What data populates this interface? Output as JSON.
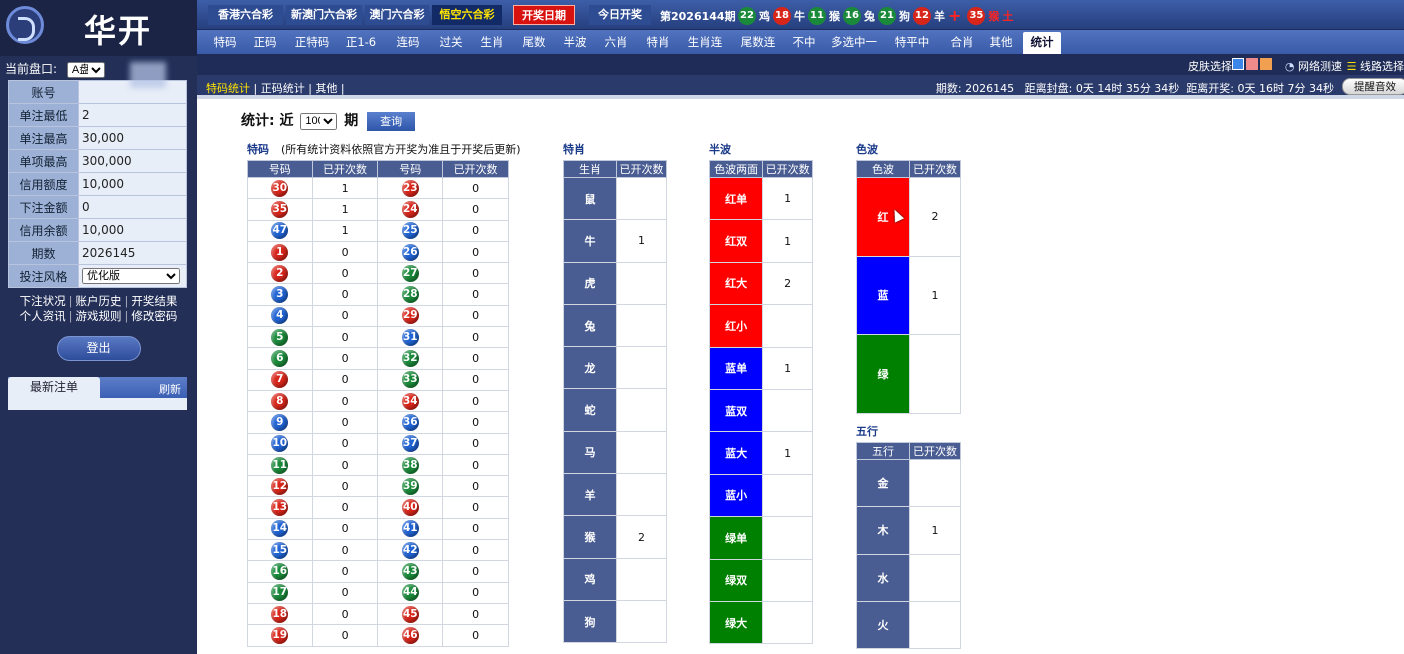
{
  "sidebar": {
    "logo_text": "华开",
    "pan_label": "当前盘口:",
    "pan_value": "A盘",
    "info": [
      {
        "k": "账号",
        "v": ""
      },
      {
        "k": "单注最低",
        "v": "2"
      },
      {
        "k": "单注最高",
        "v": "30,000"
      },
      {
        "k": "单项最高",
        "v": "300,000"
      },
      {
        "k": "信用额度",
        "v": "10,000"
      },
      {
        "k": "下注金额",
        "v": "0"
      },
      {
        "k": "信用余额",
        "v": "10,000"
      },
      {
        "k": "期数",
        "v": "2026145"
      }
    ],
    "style_label": "投注风格",
    "style_value": "优化版",
    "links_row1": [
      "下注状况",
      "账户历史",
      "开奖结果"
    ],
    "links_row2": [
      "个人资讯",
      "游戏规则",
      "修改密码"
    ],
    "logout": "登出",
    "latest_title": "最新注单",
    "refresh": "刷新"
  },
  "topbar": {
    "lottery_tabs": [
      "香港六合彩",
      "新澳门六合彩",
      "澳门六合彩",
      "悟空六合彩"
    ],
    "active_lottery": "悟空六合彩",
    "draw_date": "开奖日期",
    "today_draw": "今日开奖",
    "period_label": "第2026144期",
    "result": [
      {
        "num": "22",
        "color": "green",
        "zodiac": "鸡"
      },
      {
        "num": "18",
        "color": "red",
        "zodiac": "牛"
      },
      {
        "num": "11",
        "color": "green",
        "zodiac": "猴"
      },
      {
        "num": "16",
        "color": "green",
        "zodiac": "兔"
      },
      {
        "num": "21",
        "color": "green",
        "zodiac": "狗"
      },
      {
        "num": "12",
        "color": "red",
        "zodiac": "羊"
      }
    ],
    "special": {
      "num": "35",
      "color": "red",
      "zodiac": "猴",
      "extra": "土"
    }
  },
  "nav": [
    "特码",
    "正码",
    "正特码",
    "正1-6",
    "连码",
    "过关",
    "生肖",
    "尾数",
    "半波",
    "六肖",
    "特肖",
    "生肖连",
    "尾数连",
    "不中",
    "多选中一",
    "特平中",
    "合肖",
    "其他",
    "统计"
  ],
  "active_nav": "统计",
  "toolbar": {
    "skin_label": "皮肤选择",
    "net_test": "网络测速",
    "line_select": "线路选择"
  },
  "subbar": {
    "links": [
      "特码统计",
      "正码统计",
      "其他"
    ],
    "active": "特码统计",
    "period_info": "期数: 2026145",
    "seal_info": "距离封盘: 0天 14时 35分 34秒",
    "open_info": "距离开奖: 0天 16时 7分 34秒",
    "remind": "提醒音效"
  },
  "stats": {
    "prefix": "统计: 近",
    "count": "100",
    "suffix": "期",
    "query": "查询",
    "note": "(所有统计资料依照官方开奖为准且于开奖后更新)",
    "tm_title": "特码",
    "sx_title": "特肖",
    "bb_title": "半波",
    "sb_title": "色波",
    "wx_title": "五行",
    "h_number": "号码",
    "h_count": "已开次数",
    "h_zodiac": "生肖",
    "h_bb": "色波两面",
    "h_sb": "色波",
    "h_wx": "五行"
  },
  "special_numbers": {
    "left": [
      {
        "n": "30",
        "c": "red",
        "v": "1"
      },
      {
        "n": "35",
        "c": "red",
        "v": "1"
      },
      {
        "n": "47",
        "c": "blue",
        "v": "1"
      },
      {
        "n": "1",
        "c": "red",
        "v": "0"
      },
      {
        "n": "2",
        "c": "red",
        "v": "0"
      },
      {
        "n": "3",
        "c": "blue",
        "v": "0"
      },
      {
        "n": "4",
        "c": "blue",
        "v": "0"
      },
      {
        "n": "5",
        "c": "green",
        "v": "0"
      },
      {
        "n": "6",
        "c": "green",
        "v": "0"
      },
      {
        "n": "7",
        "c": "red",
        "v": "0"
      },
      {
        "n": "8",
        "c": "red",
        "v": "0"
      },
      {
        "n": "9",
        "c": "blue",
        "v": "0"
      },
      {
        "n": "10",
        "c": "blue",
        "v": "0"
      },
      {
        "n": "11",
        "c": "green",
        "v": "0"
      },
      {
        "n": "12",
        "c": "red",
        "v": "0"
      },
      {
        "n": "13",
        "c": "red",
        "v": "0"
      },
      {
        "n": "14",
        "c": "blue",
        "v": "0"
      },
      {
        "n": "15",
        "c": "blue",
        "v": "0"
      },
      {
        "n": "16",
        "c": "green",
        "v": "0"
      },
      {
        "n": "17",
        "c": "green",
        "v": "0"
      },
      {
        "n": "18",
        "c": "red",
        "v": "0"
      },
      {
        "n": "19",
        "c": "red",
        "v": "0"
      }
    ],
    "right": [
      {
        "n": "23",
        "c": "red",
        "v": "0"
      },
      {
        "n": "24",
        "c": "red",
        "v": "0"
      },
      {
        "n": "25",
        "c": "blue",
        "v": "0"
      },
      {
        "n": "26",
        "c": "blue",
        "v": "0"
      },
      {
        "n": "27",
        "c": "green",
        "v": "0"
      },
      {
        "n": "28",
        "c": "green",
        "v": "0"
      },
      {
        "n": "29",
        "c": "red",
        "v": "0"
      },
      {
        "n": "31",
        "c": "blue",
        "v": "0"
      },
      {
        "n": "32",
        "c": "green",
        "v": "0"
      },
      {
        "n": "33",
        "c": "green",
        "v": "0"
      },
      {
        "n": "34",
        "c": "red",
        "v": "0"
      },
      {
        "n": "36",
        "c": "blue",
        "v": "0"
      },
      {
        "n": "37",
        "c": "blue",
        "v": "0"
      },
      {
        "n": "38",
        "c": "green",
        "v": "0"
      },
      {
        "n": "39",
        "c": "green",
        "v": "0"
      },
      {
        "n": "40",
        "c": "red",
        "v": "0"
      },
      {
        "n": "41",
        "c": "blue",
        "v": "0"
      },
      {
        "n": "42",
        "c": "blue",
        "v": "0"
      },
      {
        "n": "43",
        "c": "green",
        "v": "0"
      },
      {
        "n": "44",
        "c": "green",
        "v": "0"
      },
      {
        "n": "45",
        "c": "red",
        "v": "0"
      },
      {
        "n": "46",
        "c": "red",
        "v": "0"
      }
    ]
  },
  "zodiac_counts": [
    {
      "z": "鼠",
      "v": ""
    },
    {
      "z": "牛",
      "v": "1"
    },
    {
      "z": "虎",
      "v": ""
    },
    {
      "z": "兔",
      "v": ""
    },
    {
      "z": "龙",
      "v": ""
    },
    {
      "z": "蛇",
      "v": ""
    },
    {
      "z": "马",
      "v": ""
    },
    {
      "z": "羊",
      "v": ""
    },
    {
      "z": "猴",
      "v": "2"
    },
    {
      "z": "鸡",
      "v": ""
    },
    {
      "z": "狗",
      "v": ""
    }
  ],
  "half_wave": [
    {
      "l": "红单",
      "c": "red",
      "v": "1"
    },
    {
      "l": "红双",
      "c": "red",
      "v": "1"
    },
    {
      "l": "红大",
      "c": "red",
      "v": "2"
    },
    {
      "l": "红小",
      "c": "red",
      "v": ""
    },
    {
      "l": "蓝单",
      "c": "blue",
      "v": "1"
    },
    {
      "l": "蓝双",
      "c": "blue",
      "v": ""
    },
    {
      "l": "蓝大",
      "c": "blue",
      "v": "1"
    },
    {
      "l": "蓝小",
      "c": "blue",
      "v": ""
    },
    {
      "l": "绿单",
      "c": "green",
      "v": ""
    },
    {
      "l": "绿双",
      "c": "green",
      "v": ""
    },
    {
      "l": "绿大",
      "c": "green",
      "v": ""
    }
  ],
  "color_wave": [
    {
      "l": "红",
      "c": "red",
      "v": "2"
    },
    {
      "l": "蓝",
      "c": "blue",
      "v": "1"
    },
    {
      "l": "绿",
      "c": "green",
      "v": ""
    }
  ],
  "five_elements": [
    {
      "l": "金",
      "v": ""
    },
    {
      "l": "木",
      "v": "1"
    },
    {
      "l": "水",
      "v": ""
    },
    {
      "l": "火",
      "v": ""
    }
  ],
  "colors": {
    "red": "#d8251a",
    "blue": "#1f63d4",
    "green": "#1a8a3a",
    "header": "#4a5d92"
  }
}
